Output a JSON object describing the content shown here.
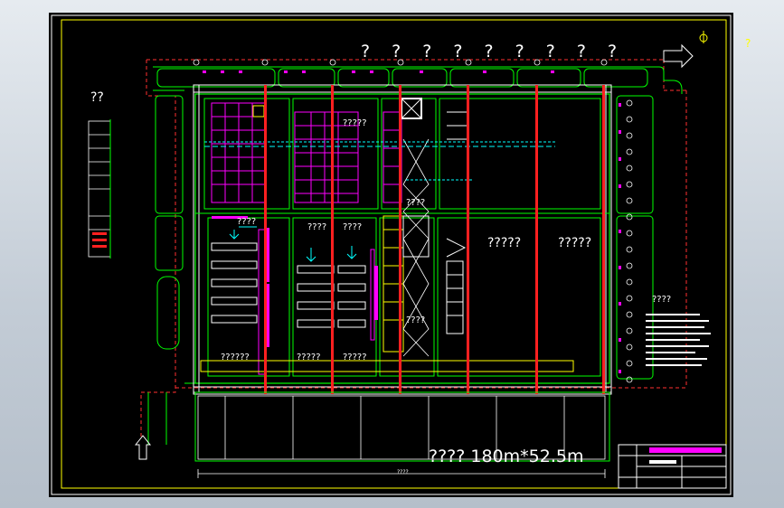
{
  "drawing": {
    "title": "? ? ? ? ? ? ? ? ?",
    "dimension_label": "???? 180m*52.5m",
    "north_mark": "?",
    "left_side_label": "??",
    "zone_labels": {
      "zone_a": "?????",
      "zone_b": "?????",
      "zone_c": "?????",
      "zone_d": "????",
      "zone_e": "????",
      "zone_f": "????",
      "zone_g": "????",
      "zone_h": "??????",
      "zone_i": "?????",
      "zone_j": "?????",
      "zone_k": "????",
      "right_side": "????"
    },
    "bottom_scale": "????"
  },
  "colors": {
    "background": "#000000",
    "outline_green": "#00ff00",
    "column_red": "#ff2020",
    "magenta": "#ff00ff",
    "cyan": "#00ffff",
    "yellow": "#ffff00",
    "white": "#ffffff",
    "dashed_red": "#ff3030"
  }
}
